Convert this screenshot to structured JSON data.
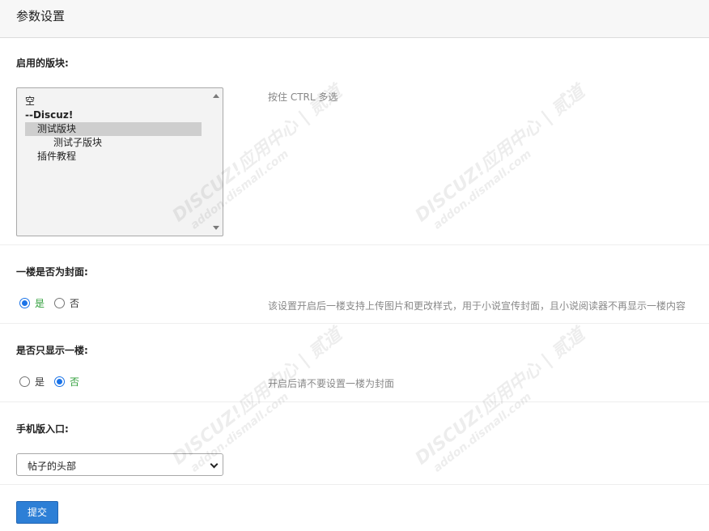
{
  "header": {
    "title": "参数设置"
  },
  "forums": {
    "label": "启用的版块:",
    "tip": "按住 CTRL 多选",
    "options": [
      {
        "text": "空",
        "level": 0,
        "bold": false,
        "selected": false
      },
      {
        "text": "--Discuz!",
        "level": 0,
        "bold": true,
        "selected": false
      },
      {
        "text": "测试版块",
        "level": 1,
        "bold": false,
        "selected": true
      },
      {
        "text": "测试子版块",
        "level": 2,
        "bold": false,
        "selected": false
      },
      {
        "text": "插件教程",
        "level": 1,
        "bold": false,
        "selected": false
      }
    ]
  },
  "cover": {
    "label": "一楼是否为封面:",
    "yes": "是",
    "no": "否",
    "selected": "yes",
    "tip": "该设置开启后一楼支持上传图片和更改样式，用于小说宣传封面，且小说阅读器不再显示一楼内容"
  },
  "only_first": {
    "label": "是否只显示一楼:",
    "yes": "是",
    "no": "否",
    "selected": "no",
    "tip": "开启后请不要设置一楼为封面"
  },
  "mobile": {
    "label": "手机版入口:",
    "selected_value": "帖子的头部"
  },
  "submit_label": "提交",
  "watermark": {
    "line1": "DISCUZ!应用中心 | 贰道",
    "line2": "addon.dismall.com"
  }
}
